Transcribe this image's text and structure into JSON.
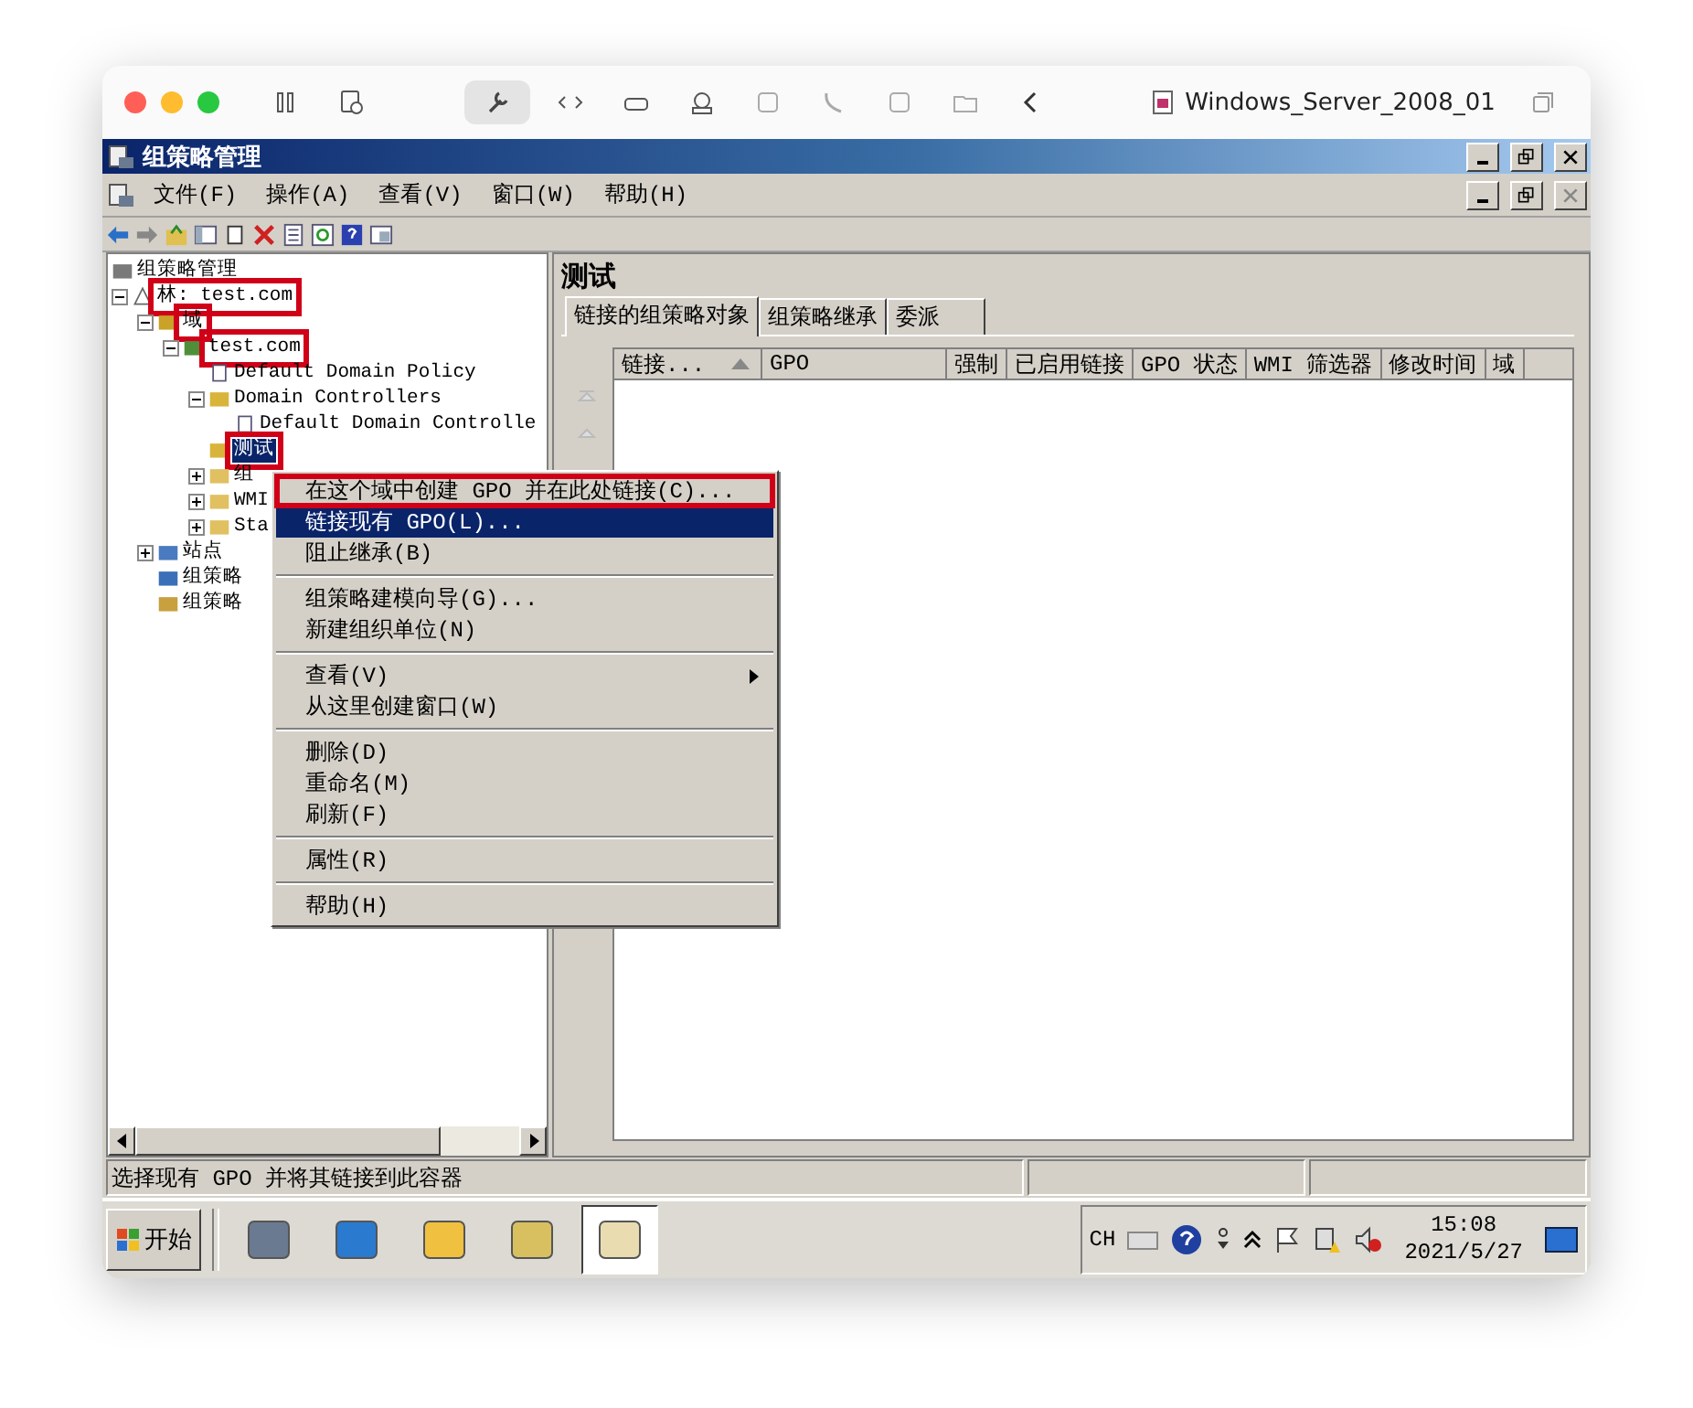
{
  "vm_window": {
    "title": "Windows_Server_2008_01"
  },
  "window": {
    "title": "组策略管理"
  },
  "menu_bar": [
    {
      "label": "文件(F)"
    },
    {
      "label": "操作(A)"
    },
    {
      "label": "查看(V)"
    },
    {
      "label": "窗口(W)"
    },
    {
      "label": "帮助(H)"
    }
  ],
  "tree": {
    "items": [
      {
        "label": "组策略管理",
        "kind": "root",
        "selected": false,
        "children": [
          {
            "label": "林: test.com",
            "kind": "forest",
            "expanded": true,
            "annotated": true,
            "selected": false,
            "children": [
              {
                "label": "域",
                "kind": "domains",
                "expanded": true,
                "annotated": true,
                "selected": false,
                "children": [
                  {
                    "label": "test.com",
                    "kind": "domain",
                    "expanded": true,
                    "annotated": true,
                    "selected": false,
                    "children": [
                      {
                        "label": "Default Domain Policy",
                        "kind": "gpo",
                        "selected": false
                      },
                      {
                        "label": "Domain Controllers",
                        "kind": "ou",
                        "expanded": true,
                        "selected": false,
                        "children": [
                          {
                            "label": "Default Domain Controlle",
                            "kind": "gpo",
                            "selected": false
                          }
                        ]
                      },
                      {
                        "label": "测试",
                        "kind": "ou",
                        "annotated": true,
                        "selected": true
                      },
                      {
                        "label": "组",
                        "kind": "folder",
                        "expanded": false,
                        "selected": false
                      },
                      {
                        "label": "WMI",
                        "kind": "folder",
                        "expanded": false,
                        "selected": false
                      },
                      {
                        "label": "Sta",
                        "kind": "folder",
                        "expanded": false,
                        "selected": false
                      }
                    ]
                  }
                ]
              },
              {
                "label": "站点",
                "kind": "site",
                "expanded": false,
                "selected": false
              },
              {
                "label": "组策略",
                "kind": "modeling",
                "selected": false
              },
              {
                "label": "组策略",
                "kind": "results",
                "selected": false
              }
            ]
          }
        ]
      }
    ]
  },
  "details": {
    "title": "测试",
    "tabs": [
      {
        "label": "链接的组策略对象",
        "selected": true
      },
      {
        "label": "组策略继承",
        "selected": false
      },
      {
        "label": "委派",
        "selected": false
      }
    ],
    "columns": [
      {
        "label": "链接...",
        "sorted": true
      },
      {
        "label": "GPO",
        "sorted": false
      },
      {
        "label": "强制",
        "sorted": false
      },
      {
        "label": "已启用链接",
        "sorted": false
      },
      {
        "label": "GPO 状态",
        "sorted": false
      },
      {
        "label": "WMI 筛选器",
        "sorted": false
      },
      {
        "label": "修改时间",
        "sorted": false
      },
      {
        "label": "域",
        "sorted": false
      }
    ]
  },
  "context_menu": {
    "items": [
      {
        "kind": "item",
        "label": "在这个域中创建 GPO 并在此处链接(C)...",
        "selected": false,
        "annotated": true
      },
      {
        "kind": "item",
        "label": "链接现有 GPO(L)...",
        "selected": true
      },
      {
        "kind": "item",
        "label": "阻止继承(B)",
        "selected": false
      },
      {
        "kind": "separator"
      },
      {
        "kind": "item",
        "label": "组策略建模向导(G)...",
        "selected": false
      },
      {
        "kind": "item",
        "label": "新建组织单位(N)",
        "selected": false
      },
      {
        "kind": "separator"
      },
      {
        "kind": "item",
        "label": "查看(V)",
        "selected": false,
        "submenu": true
      },
      {
        "kind": "item",
        "label": "从这里创建窗口(W)",
        "selected": false
      },
      {
        "kind": "separator"
      },
      {
        "kind": "item",
        "label": "删除(D)",
        "selected": false
      },
      {
        "kind": "item",
        "label": "重命名(M)",
        "selected": false
      },
      {
        "kind": "item",
        "label": "刷新(F)",
        "selected": false
      },
      {
        "kind": "separator"
      },
      {
        "kind": "item",
        "label": "属性(R)",
        "selected": false
      },
      {
        "kind": "separator"
      },
      {
        "kind": "item",
        "label": "帮助(H)",
        "selected": false
      }
    ]
  },
  "status_bar": {
    "text": "选择现有 GPO 并将其链接到此容器"
  },
  "taskbar": {
    "start": "开始",
    "apps": [
      {
        "kind": "server",
        "selected": false
      },
      {
        "kind": "shell",
        "selected": false
      },
      {
        "kind": "folder",
        "selected": false
      },
      {
        "kind": "drive",
        "selected": false
      },
      {
        "kind": "policy",
        "selected": true
      }
    ],
    "language": "CH",
    "time": "15:08",
    "date": "2021/5/27"
  }
}
